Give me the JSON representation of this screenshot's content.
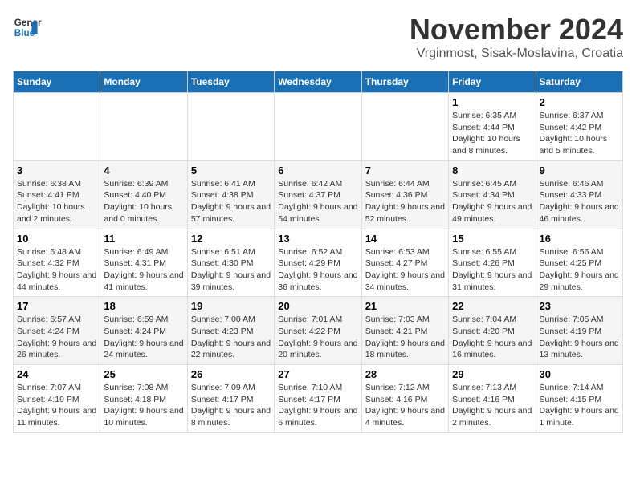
{
  "header": {
    "logo_line1": "General",
    "logo_line2": "Blue",
    "title": "November 2024",
    "subtitle": "Vrginmost, Sisak-Moslavina, Croatia"
  },
  "weekdays": [
    "Sunday",
    "Monday",
    "Tuesday",
    "Wednesday",
    "Thursday",
    "Friday",
    "Saturday"
  ],
  "weeks": [
    [
      {
        "day": "",
        "info": ""
      },
      {
        "day": "",
        "info": ""
      },
      {
        "day": "",
        "info": ""
      },
      {
        "day": "",
        "info": ""
      },
      {
        "day": "",
        "info": ""
      },
      {
        "day": "1",
        "info": "Sunrise: 6:35 AM\nSunset: 4:44 PM\nDaylight: 10 hours and 8 minutes."
      },
      {
        "day": "2",
        "info": "Sunrise: 6:37 AM\nSunset: 4:42 PM\nDaylight: 10 hours and 5 minutes."
      }
    ],
    [
      {
        "day": "3",
        "info": "Sunrise: 6:38 AM\nSunset: 4:41 PM\nDaylight: 10 hours and 2 minutes."
      },
      {
        "day": "4",
        "info": "Sunrise: 6:39 AM\nSunset: 4:40 PM\nDaylight: 10 hours and 0 minutes."
      },
      {
        "day": "5",
        "info": "Sunrise: 6:41 AM\nSunset: 4:38 PM\nDaylight: 9 hours and 57 minutes."
      },
      {
        "day": "6",
        "info": "Sunrise: 6:42 AM\nSunset: 4:37 PM\nDaylight: 9 hours and 54 minutes."
      },
      {
        "day": "7",
        "info": "Sunrise: 6:44 AM\nSunset: 4:36 PM\nDaylight: 9 hours and 52 minutes."
      },
      {
        "day": "8",
        "info": "Sunrise: 6:45 AM\nSunset: 4:34 PM\nDaylight: 9 hours and 49 minutes."
      },
      {
        "day": "9",
        "info": "Sunrise: 6:46 AM\nSunset: 4:33 PM\nDaylight: 9 hours and 46 minutes."
      }
    ],
    [
      {
        "day": "10",
        "info": "Sunrise: 6:48 AM\nSunset: 4:32 PM\nDaylight: 9 hours and 44 minutes."
      },
      {
        "day": "11",
        "info": "Sunrise: 6:49 AM\nSunset: 4:31 PM\nDaylight: 9 hours and 41 minutes."
      },
      {
        "day": "12",
        "info": "Sunrise: 6:51 AM\nSunset: 4:30 PM\nDaylight: 9 hours and 39 minutes."
      },
      {
        "day": "13",
        "info": "Sunrise: 6:52 AM\nSunset: 4:29 PM\nDaylight: 9 hours and 36 minutes."
      },
      {
        "day": "14",
        "info": "Sunrise: 6:53 AM\nSunset: 4:27 PM\nDaylight: 9 hours and 34 minutes."
      },
      {
        "day": "15",
        "info": "Sunrise: 6:55 AM\nSunset: 4:26 PM\nDaylight: 9 hours and 31 minutes."
      },
      {
        "day": "16",
        "info": "Sunrise: 6:56 AM\nSunset: 4:25 PM\nDaylight: 9 hours and 29 minutes."
      }
    ],
    [
      {
        "day": "17",
        "info": "Sunrise: 6:57 AM\nSunset: 4:24 PM\nDaylight: 9 hours and 26 minutes."
      },
      {
        "day": "18",
        "info": "Sunrise: 6:59 AM\nSunset: 4:24 PM\nDaylight: 9 hours and 24 minutes."
      },
      {
        "day": "19",
        "info": "Sunrise: 7:00 AM\nSunset: 4:23 PM\nDaylight: 9 hours and 22 minutes."
      },
      {
        "day": "20",
        "info": "Sunrise: 7:01 AM\nSunset: 4:22 PM\nDaylight: 9 hours and 20 minutes."
      },
      {
        "day": "21",
        "info": "Sunrise: 7:03 AM\nSunset: 4:21 PM\nDaylight: 9 hours and 18 minutes."
      },
      {
        "day": "22",
        "info": "Sunrise: 7:04 AM\nSunset: 4:20 PM\nDaylight: 9 hours and 16 minutes."
      },
      {
        "day": "23",
        "info": "Sunrise: 7:05 AM\nSunset: 4:19 PM\nDaylight: 9 hours and 13 minutes."
      }
    ],
    [
      {
        "day": "24",
        "info": "Sunrise: 7:07 AM\nSunset: 4:19 PM\nDaylight: 9 hours and 11 minutes."
      },
      {
        "day": "25",
        "info": "Sunrise: 7:08 AM\nSunset: 4:18 PM\nDaylight: 9 hours and 10 minutes."
      },
      {
        "day": "26",
        "info": "Sunrise: 7:09 AM\nSunset: 4:17 PM\nDaylight: 9 hours and 8 minutes."
      },
      {
        "day": "27",
        "info": "Sunrise: 7:10 AM\nSunset: 4:17 PM\nDaylight: 9 hours and 6 minutes."
      },
      {
        "day": "28",
        "info": "Sunrise: 7:12 AM\nSunset: 4:16 PM\nDaylight: 9 hours and 4 minutes."
      },
      {
        "day": "29",
        "info": "Sunrise: 7:13 AM\nSunset: 4:16 PM\nDaylight: 9 hours and 2 minutes."
      },
      {
        "day": "30",
        "info": "Sunrise: 7:14 AM\nSunset: 4:15 PM\nDaylight: 9 hours and 1 minute."
      }
    ]
  ]
}
